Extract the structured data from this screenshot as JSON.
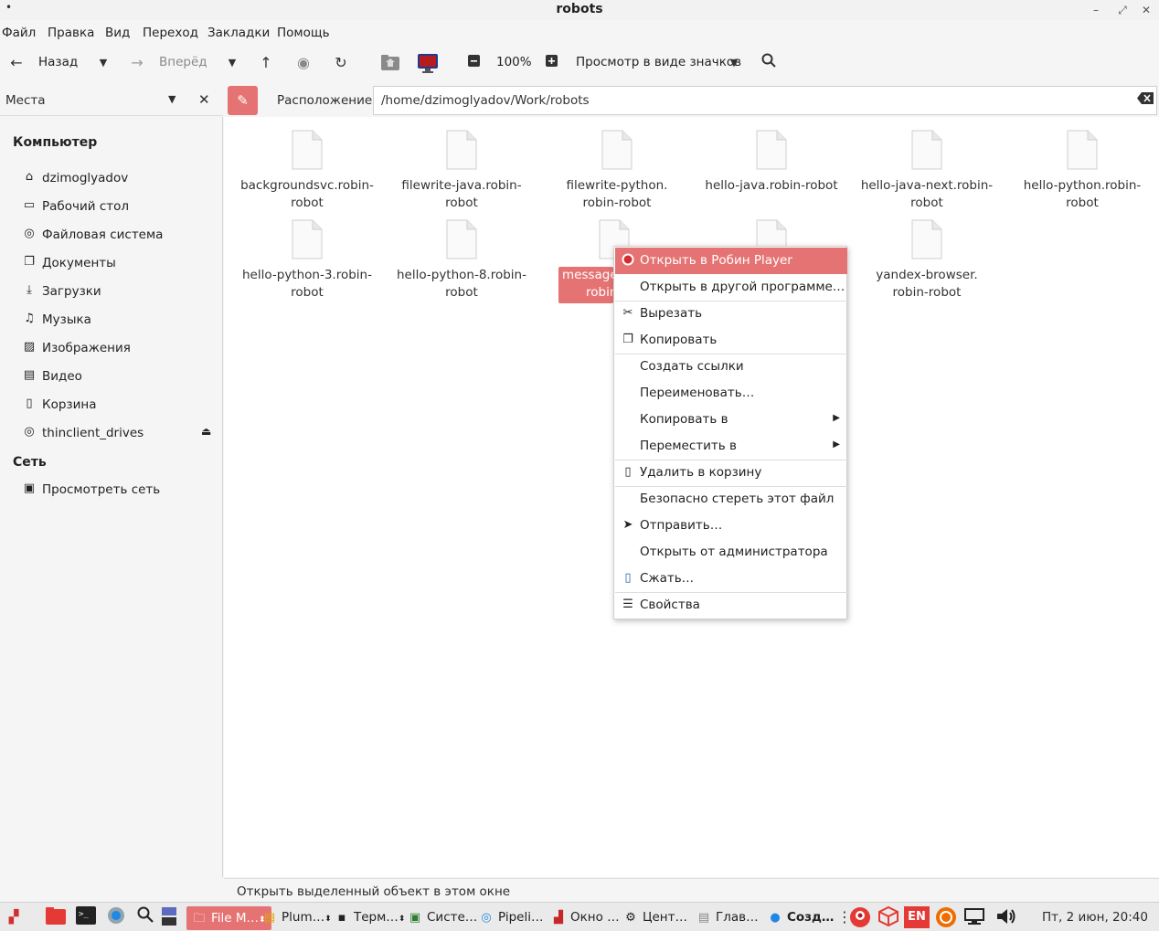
{
  "window": {
    "title": "robots"
  },
  "menubar": {
    "file": "Файл",
    "edit": "Правка",
    "view": "Вид",
    "go": "Переход",
    "bookmarks": "Закладки",
    "help": "Помощь"
  },
  "toolbar": {
    "back": "Назад",
    "forward": "Вперёд",
    "zoom": "100%",
    "view_mode": "Просмотр в виде значков"
  },
  "places": {
    "label": "Места"
  },
  "location": {
    "label": "Расположение:",
    "path": "/home/dzimoglyadov/Work/robots"
  },
  "sidebar": {
    "computer_title": "Компьютер",
    "computer": [
      {
        "label": "dzimoglyadov",
        "icon": "home-icon"
      },
      {
        "label": "Рабочий стол",
        "icon": "desktop-icon"
      },
      {
        "label": "Файловая система",
        "icon": "disk-icon"
      },
      {
        "label": "Документы",
        "icon": "documents-icon"
      },
      {
        "label": "Загрузки",
        "icon": "download-icon"
      },
      {
        "label": "Музыка",
        "icon": "music-icon"
      },
      {
        "label": "Изображения",
        "icon": "image-icon"
      },
      {
        "label": "Видео",
        "icon": "video-icon"
      },
      {
        "label": "Корзина",
        "icon": "trash-icon"
      },
      {
        "label": "thinclient_drives",
        "icon": "drive-icon"
      }
    ],
    "network_title": "Сеть",
    "network": [
      {
        "label": "Просмотреть сеть",
        "icon": "network-icon"
      }
    ]
  },
  "files": [
    {
      "line1": "backgroundsvc.robin-",
      "line2": "robot"
    },
    {
      "line1": "filewrite-java.robin-",
      "line2": "robot"
    },
    {
      "line1": "filewrite-python.",
      "line2": "robin-robot"
    },
    {
      "line1": "hello-java.robin-robot",
      "line2": ""
    },
    {
      "line1": "hello-java-next.robin-",
      "line2": "robot"
    },
    {
      "line1": "hello-python.robin-",
      "line2": "robot"
    },
    {
      "line1": "hello-python-3.robin-",
      "line2": "robot"
    },
    {
      "line1": "hello-python-8.robin-",
      "line2": "robot"
    },
    {
      "line1": "messageb",
      "line2": "robin"
    },
    {
      "line1": "",
      "line2": ""
    },
    {
      "line1": "yandex-browser.",
      "line2": "robin-robot"
    }
  ],
  "context_menu": [
    {
      "label": "Открыть в Робин Player",
      "icon": "robin-icon"
    },
    {
      "label": "Открыть в другой программе…",
      "icon": ""
    },
    {
      "label": "Вырезать",
      "icon": "scissors-icon"
    },
    {
      "label": "Копировать",
      "icon": "copy-icon"
    },
    {
      "label": "Создать ссылки",
      "icon": ""
    },
    {
      "label": "Переименовать…",
      "icon": ""
    },
    {
      "label": "Копировать в",
      "icon": ""
    },
    {
      "label": "Переместить в",
      "icon": ""
    },
    {
      "label": "Удалить в корзину",
      "icon": "trash-icon"
    },
    {
      "label": "Безопасно стереть этот файл",
      "icon": ""
    },
    {
      "label": "Отправить…",
      "icon": "send-icon"
    },
    {
      "label": "Открыть от администратора",
      "icon": ""
    },
    {
      "label": "Сжать…",
      "icon": "archive-icon"
    },
    {
      "label": "Свойства",
      "icon": "properties-icon"
    }
  ],
  "statusbar": {
    "text": "Открыть выделенный объект в этом окне"
  },
  "taskbar": {
    "tasks": [
      {
        "label": "File M…"
      },
      {
        "label": "Plum…"
      },
      {
        "label": "Терм…"
      },
      {
        "label": "Систе…"
      },
      {
        "label": "Pipeli…"
      },
      {
        "label": "Окно …"
      },
      {
        "label": "Цент…"
      },
      {
        "label": "Глав…"
      },
      {
        "label": "Созд…"
      }
    ],
    "lang": "EN",
    "clock": "Пт, 2 июн, 20:40"
  },
  "colors": {
    "accent": "#e57373"
  }
}
